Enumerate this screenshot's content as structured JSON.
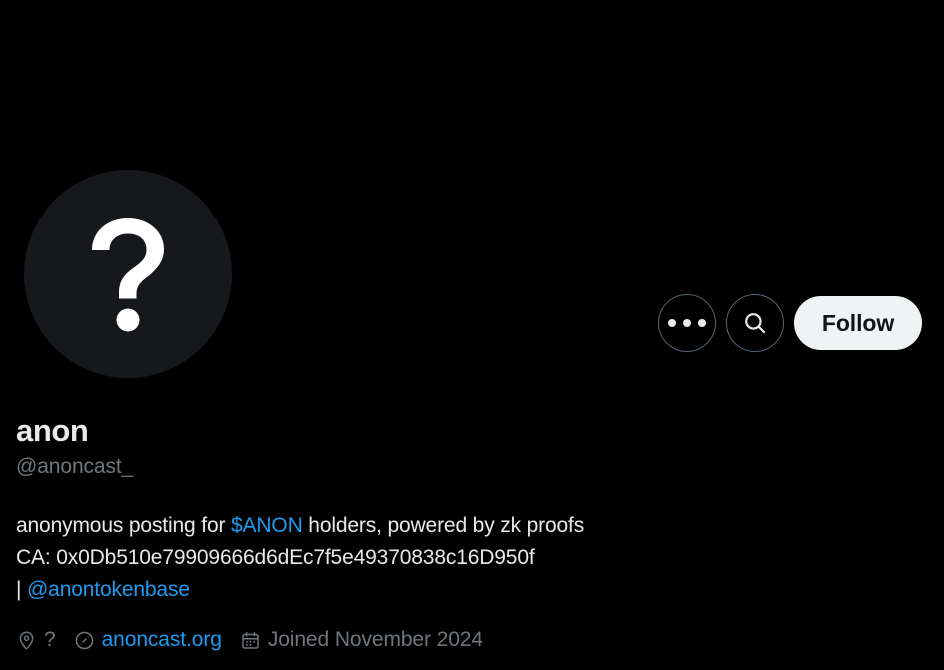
{
  "theme": {
    "background": "#000000",
    "text_primary": "#e7e9ea",
    "text_muted": "#71767b",
    "accent_link": "#1d9bf0",
    "follow_bg": "#eff3f4",
    "follow_text": "#0f1419",
    "avatar_bg": "#16181c",
    "border": "#536471"
  },
  "profile": {
    "display_name": "anon",
    "handle": "@anoncast_",
    "avatar_icon": "question-mark-icon",
    "bio": {
      "line1_part1": "anonymous posting for ",
      "line1_cashtag": "$ANON",
      "line1_part2": " holders, powered by zk proofs",
      "line2": "CA: 0x0Db510e79909666d6dEc7f5e49370838c16D950f",
      "line3_prefix": "| ",
      "line3_mention": "@anontokenbase"
    }
  },
  "actions": {
    "more_label": "more-options",
    "more_icon": "ellipsis-icon",
    "search_label": "search-profile",
    "search_icon": "search-icon",
    "follow_label": "Follow"
  },
  "meta": {
    "location_icon": "location-pin-icon",
    "location": "?",
    "link_icon": "link-icon",
    "website": "anoncast.org",
    "calendar_icon": "calendar-icon",
    "joined": "Joined November 2024"
  }
}
